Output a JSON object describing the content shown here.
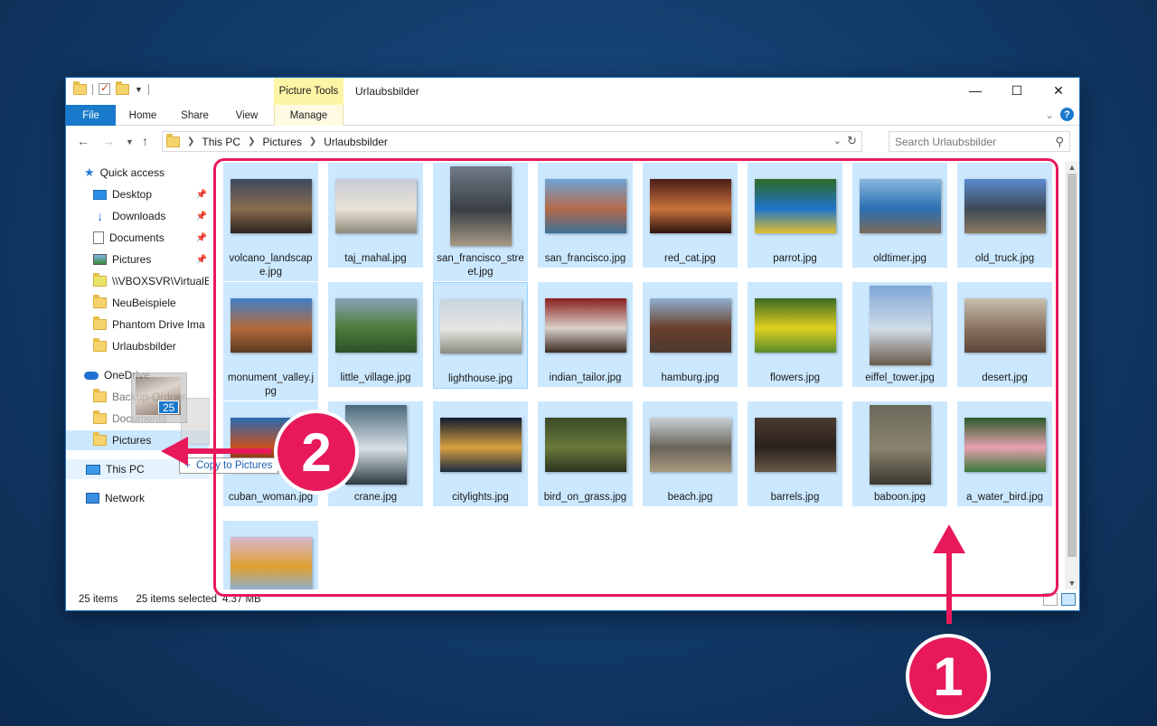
{
  "window": {
    "title": "Urlaubsbilder",
    "contextual_group": "Picture Tools",
    "controls": {
      "minimize": "—",
      "maximize": "☐",
      "close": "✕"
    }
  },
  "ribbon": {
    "tabs": [
      {
        "label": "File"
      },
      {
        "label": "Home"
      },
      {
        "label": "Share"
      },
      {
        "label": "View"
      },
      {
        "label": "Manage"
      }
    ],
    "help": "?"
  },
  "address": {
    "crumbs": [
      "This PC",
      "Pictures",
      "Urlaubsbilder"
    ],
    "search_placeholder": "Search Urlaubsbilder"
  },
  "sidebar": {
    "quick_access": "Quick access",
    "items": [
      {
        "label": "Desktop",
        "icon": "desktop-icon",
        "pinned": true
      },
      {
        "label": "Downloads",
        "icon": "download-icon",
        "pinned": true
      },
      {
        "label": "Documents",
        "icon": "document-icon",
        "pinned": true
      },
      {
        "label": "Pictures",
        "icon": "pictures-icon",
        "pinned": true
      },
      {
        "label": "\\\\VBOXSVR\\VirtualE",
        "icon": "network-folder-icon",
        "pinned": false
      },
      {
        "label": "NeuBeispiele",
        "icon": "folder-icon",
        "pinned": false
      },
      {
        "label": "Phantom Drive Ima",
        "icon": "folder-icon",
        "pinned": false
      },
      {
        "label": "Urlaubsbilder",
        "icon": "folder-icon",
        "pinned": false
      }
    ],
    "onedrive": "OneDrive",
    "onedrive_items": [
      {
        "label": "Backup-Ordner"
      },
      {
        "label": "Documents"
      },
      {
        "label": "Pictures"
      }
    ],
    "this_pc": "This PC",
    "network": "Network"
  },
  "drag": {
    "count": "25",
    "tooltip": "Copy to Pictures",
    "plus": "+"
  },
  "files": [
    {
      "name": "volcano_landscape.jpg",
      "colors": [
        "#3d4a5e",
        "#8a6b4f",
        "#2b2420"
      ],
      "orient": "land"
    },
    {
      "name": "taj_mahal.jpg",
      "colors": [
        "#c9ccd6",
        "#e8e2d7",
        "#8f8b7a"
      ],
      "orient": "land"
    },
    {
      "name": "san_francisco_street.jpg",
      "colors": [
        "#6f7b86",
        "#3a3f45",
        "#a89a84"
      ],
      "orient": "port"
    },
    {
      "name": "san_francisco.jpg",
      "colors": [
        "#6fa4d6",
        "#b56a4a",
        "#3d6f96"
      ],
      "orient": "land"
    },
    {
      "name": "red_cat.jpg",
      "colors": [
        "#4a1c18",
        "#c9733c",
        "#2d1410"
      ],
      "orient": "land"
    },
    {
      "name": "parrot.jpg",
      "colors": [
        "#2f6a28",
        "#1e73c8",
        "#e0c030"
      ],
      "orient": "land"
    },
    {
      "name": "oldtimer.jpg",
      "colors": [
        "#8ab8e0",
        "#2a6fb0",
        "#7a6a5a"
      ],
      "orient": "land"
    },
    {
      "name": "old_truck.jpg",
      "colors": [
        "#5a8ad0",
        "#3e4a56",
        "#8a7a62"
      ],
      "orient": "land"
    },
    {
      "name": "monument_valley.jpg",
      "colors": [
        "#3f7fc8",
        "#b56a3a",
        "#5a3a22"
      ],
      "orient": "land"
    },
    {
      "name": "little_village.jpg",
      "colors": [
        "#8aa2b6",
        "#4b7d3a",
        "#2f4f2a"
      ],
      "orient": "land"
    },
    {
      "name": "lighthouse.jpg",
      "colors": [
        "#c8d6e0",
        "#e6e6e0",
        "#8a8a80"
      ],
      "orient": "land"
    },
    {
      "name": "indian_tailor.jpg",
      "colors": [
        "#8b1e1e",
        "#d8d0c8",
        "#3b2a22"
      ],
      "orient": "land"
    },
    {
      "name": "hamburg.jpg",
      "colors": [
        "#8fb0d0",
        "#6a3e2a",
        "#4a3a30"
      ],
      "orient": "land"
    },
    {
      "name": "flowers.jpg",
      "colors": [
        "#3b6a22",
        "#e0d020",
        "#5a8a2a"
      ],
      "orient": "land"
    },
    {
      "name": "eiffel_tower.jpg",
      "colors": [
        "#7fa8d8",
        "#d0dbe6",
        "#6a5a4a"
      ],
      "orient": "port"
    },
    {
      "name": "desert.jpg",
      "colors": [
        "#c8c0b0",
        "#8a7260",
        "#5a4638"
      ],
      "orient": "land"
    },
    {
      "name": "cuban_woman.jpg",
      "colors": [
        "#2a6ab0",
        "#c8501e",
        "#3a2418"
      ],
      "orient": "land"
    },
    {
      "name": "crane.jpg",
      "colors": [
        "#4a6a7a",
        "#d8e0e6",
        "#2a3a40"
      ],
      "orient": "port"
    },
    {
      "name": "citylights.jpg",
      "colors": [
        "#0e1a2e",
        "#d8a040",
        "#1a2a40"
      ],
      "orient": "land"
    },
    {
      "name": "bird_on_grass.jpg",
      "colors": [
        "#3a4a28",
        "#6a7a3a",
        "#2a3220"
      ],
      "orient": "land"
    },
    {
      "name": "beach.jpg",
      "colors": [
        "#c8d0d6",
        "#6a6458",
        "#a89a80"
      ],
      "orient": "land"
    },
    {
      "name": "barrels.jpg",
      "colors": [
        "#4a3a30",
        "#2a221c",
        "#6a5a48"
      ],
      "orient": "land"
    },
    {
      "name": "baboon.jpg",
      "colors": [
        "#6a6a5a",
        "#8a8270",
        "#3a3a30"
      ],
      "orient": "port"
    },
    {
      "name": "a_water_bird.jpg",
      "colors": [
        "#2a5a2a",
        "#e8a0b0",
        "#3a7a3a"
      ],
      "orient": "land"
    },
    {
      "name": "",
      "colors": [
        "#d8b8d0",
        "#e0a030",
        "#8ab0d8"
      ],
      "orient": "land"
    }
  ],
  "status": {
    "items": "25 items",
    "selected": "25 items selected",
    "size": "4.37 MB"
  },
  "callouts": {
    "one": "1",
    "two": "2"
  },
  "colors": {
    "accent": "#e8195a",
    "selection": "#cce8ff",
    "file_tab": "#1979ca"
  }
}
